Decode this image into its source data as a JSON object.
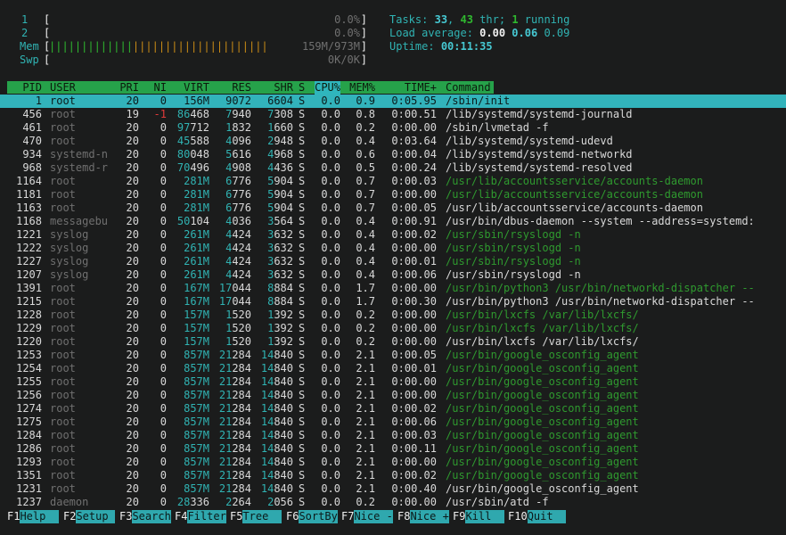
{
  "meters": {
    "cpu1": {
      "label": "1",
      "bar": "",
      "value": "0.0%"
    },
    "cpu2": {
      "label": "2",
      "bar": "",
      "value": "0.0%"
    },
    "mem": {
      "label": "Mem",
      "bar_green": "|||||||||||||",
      "bar_orange": "|||||||||||||||||||||",
      "value": "159M/973M"
    },
    "swp": {
      "label": "Swp",
      "bar": "",
      "value": "0K/0K"
    }
  },
  "summary": {
    "tasks_label": "Tasks:",
    "tasks": "33",
    "threads": "43",
    "thr_label": "thr;",
    "running": "1",
    "running_label": "running",
    "load_label": "Load average:",
    "load1": "0.00",
    "load5": "0.06",
    "load15": "0.09",
    "uptime_label": "Uptime:",
    "uptime": "00:11:35"
  },
  "columns": {
    "pid": "PID",
    "user": "USER",
    "pri": "PRI",
    "ni": "NI",
    "virt": "VIRT",
    "res": "RES",
    "shr": "SHR",
    "s": "S",
    "cpu": "CPU%",
    "mem": "MEM%",
    "time": "TIME+",
    "command": "Command"
  },
  "processes": [
    {
      "pid": "1",
      "user": "root",
      "pri": "20",
      "ni": "0",
      "virt": "156M",
      "res": "9072",
      "shr": "6604",
      "s": "S",
      "cpu": "0.0",
      "mem": "0.9",
      "time": "0:05.95",
      "cmd": "/sbin/init",
      "selected": true
    },
    {
      "pid": "456",
      "user": "root",
      "pri": "19",
      "ni": "-1",
      "virt": "86468",
      "res": "7940",
      "shr": "7308",
      "s": "S",
      "cpu": "0.0",
      "mem": "0.8",
      "time": "0:00.51",
      "cmd": "/lib/systemd/systemd-journald"
    },
    {
      "pid": "461",
      "user": "root",
      "pri": "20",
      "ni": "0",
      "virt": "97712",
      "res": "1832",
      "shr": "1660",
      "s": "S",
      "cpu": "0.0",
      "mem": "0.2",
      "time": "0:00.00",
      "cmd": "/sbin/lvmetad -f"
    },
    {
      "pid": "470",
      "user": "root",
      "pri": "20",
      "ni": "0",
      "virt": "45588",
      "res": "4096",
      "shr": "2948",
      "s": "S",
      "cpu": "0.0",
      "mem": "0.4",
      "time": "0:03.64",
      "cmd": "/lib/systemd/systemd-udevd"
    },
    {
      "pid": "934",
      "user": "systemd-n",
      "pri": "20",
      "ni": "0",
      "virt": "80048",
      "res": "5616",
      "shr": "4968",
      "s": "S",
      "cpu": "0.0",
      "mem": "0.6",
      "time": "0:00.04",
      "cmd": "/lib/systemd/systemd-networkd"
    },
    {
      "pid": "968",
      "user": "systemd-r",
      "pri": "20",
      "ni": "0",
      "virt": "70496",
      "res": "4908",
      "shr": "4436",
      "s": "S",
      "cpu": "0.0",
      "mem": "0.5",
      "time": "0:00.24",
      "cmd": "/lib/systemd/systemd-resolved"
    },
    {
      "pid": "1164",
      "user": "root",
      "pri": "20",
      "ni": "0",
      "virt": "281M",
      "res": "6776",
      "shr": "5904",
      "s": "S",
      "cpu": "0.0",
      "mem": "0.7",
      "time": "0:00.03",
      "cmd": "/usr/lib/accountsservice/accounts-daemon",
      "thread": true
    },
    {
      "pid": "1181",
      "user": "root",
      "pri": "20",
      "ni": "0",
      "virt": "281M",
      "res": "6776",
      "shr": "5904",
      "s": "S",
      "cpu": "0.0",
      "mem": "0.7",
      "time": "0:00.00",
      "cmd": "/usr/lib/accountsservice/accounts-daemon",
      "thread": true
    },
    {
      "pid": "1163",
      "user": "root",
      "pri": "20",
      "ni": "0",
      "virt": "281M",
      "res": "6776",
      "shr": "5904",
      "s": "S",
      "cpu": "0.0",
      "mem": "0.7",
      "time": "0:00.05",
      "cmd": "/usr/lib/accountsservice/accounts-daemon"
    },
    {
      "pid": "1168",
      "user": "messagebu",
      "pri": "20",
      "ni": "0",
      "virt": "50104",
      "res": "4036",
      "shr": "3564",
      "s": "S",
      "cpu": "0.0",
      "mem": "0.4",
      "time": "0:00.91",
      "cmd": "/usr/bin/dbus-daemon --system --address=systemd:"
    },
    {
      "pid": "1221",
      "user": "syslog",
      "pri": "20",
      "ni": "0",
      "virt": "261M",
      "res": "4424",
      "shr": "3632",
      "s": "S",
      "cpu": "0.0",
      "mem": "0.4",
      "time": "0:00.02",
      "cmd": "/usr/sbin/rsyslogd -n",
      "thread": true
    },
    {
      "pid": "1222",
      "user": "syslog",
      "pri": "20",
      "ni": "0",
      "virt": "261M",
      "res": "4424",
      "shr": "3632",
      "s": "S",
      "cpu": "0.0",
      "mem": "0.4",
      "time": "0:00.00",
      "cmd": "/usr/sbin/rsyslogd -n",
      "thread": true
    },
    {
      "pid": "1227",
      "user": "syslog",
      "pri": "20",
      "ni": "0",
      "virt": "261M",
      "res": "4424",
      "shr": "3632",
      "s": "S",
      "cpu": "0.0",
      "mem": "0.4",
      "time": "0:00.01",
      "cmd": "/usr/sbin/rsyslogd -n",
      "thread": true
    },
    {
      "pid": "1207",
      "user": "syslog",
      "pri": "20",
      "ni": "0",
      "virt": "261M",
      "res": "4424",
      "shr": "3632",
      "s": "S",
      "cpu": "0.0",
      "mem": "0.4",
      "time": "0:00.06",
      "cmd": "/usr/sbin/rsyslogd -n"
    },
    {
      "pid": "1391",
      "user": "root",
      "pri": "20",
      "ni": "0",
      "virt": "167M",
      "res": "17044",
      "shr": "8884",
      "s": "S",
      "cpu": "0.0",
      "mem": "1.7",
      "time": "0:00.00",
      "cmd": "/usr/bin/python3 /usr/bin/networkd-dispatcher --",
      "thread": true
    },
    {
      "pid": "1215",
      "user": "root",
      "pri": "20",
      "ni": "0",
      "virt": "167M",
      "res": "17044",
      "shr": "8884",
      "s": "S",
      "cpu": "0.0",
      "mem": "1.7",
      "time": "0:00.30",
      "cmd": "/usr/bin/python3 /usr/bin/networkd-dispatcher --"
    },
    {
      "pid": "1228",
      "user": "root",
      "pri": "20",
      "ni": "0",
      "virt": "157M",
      "res": "1520",
      "shr": "1392",
      "s": "S",
      "cpu": "0.0",
      "mem": "0.2",
      "time": "0:00.00",
      "cmd": "/usr/bin/lxcfs /var/lib/lxcfs/",
      "thread": true
    },
    {
      "pid": "1229",
      "user": "root",
      "pri": "20",
      "ni": "0",
      "virt": "157M",
      "res": "1520",
      "shr": "1392",
      "s": "S",
      "cpu": "0.0",
      "mem": "0.2",
      "time": "0:00.00",
      "cmd": "/usr/bin/lxcfs /var/lib/lxcfs/",
      "thread": true
    },
    {
      "pid": "1220",
      "user": "root",
      "pri": "20",
      "ni": "0",
      "virt": "157M",
      "res": "1520",
      "shr": "1392",
      "s": "S",
      "cpu": "0.0",
      "mem": "0.2",
      "time": "0:00.00",
      "cmd": "/usr/bin/lxcfs /var/lib/lxcfs/"
    },
    {
      "pid": "1253",
      "user": "root",
      "pri": "20",
      "ni": "0",
      "virt": "857M",
      "res": "21284",
      "shr": "14840",
      "s": "S",
      "cpu": "0.0",
      "mem": "2.1",
      "time": "0:00.05",
      "cmd": "/usr/bin/google_osconfig_agent",
      "thread": true
    },
    {
      "pid": "1254",
      "user": "root",
      "pri": "20",
      "ni": "0",
      "virt": "857M",
      "res": "21284",
      "shr": "14840",
      "s": "S",
      "cpu": "0.0",
      "mem": "2.1",
      "time": "0:00.01",
      "cmd": "/usr/bin/google_osconfig_agent",
      "thread": true
    },
    {
      "pid": "1255",
      "user": "root",
      "pri": "20",
      "ni": "0",
      "virt": "857M",
      "res": "21284",
      "shr": "14840",
      "s": "S",
      "cpu": "0.0",
      "mem": "2.1",
      "time": "0:00.00",
      "cmd": "/usr/bin/google_osconfig_agent",
      "thread": true
    },
    {
      "pid": "1256",
      "user": "root",
      "pri": "20",
      "ni": "0",
      "virt": "857M",
      "res": "21284",
      "shr": "14840",
      "s": "S",
      "cpu": "0.0",
      "mem": "2.1",
      "time": "0:00.00",
      "cmd": "/usr/bin/google_osconfig_agent",
      "thread": true
    },
    {
      "pid": "1274",
      "user": "root",
      "pri": "20",
      "ni": "0",
      "virt": "857M",
      "res": "21284",
      "shr": "14840",
      "s": "S",
      "cpu": "0.0",
      "mem": "2.1",
      "time": "0:00.02",
      "cmd": "/usr/bin/google_osconfig_agent",
      "thread": true
    },
    {
      "pid": "1275",
      "user": "root",
      "pri": "20",
      "ni": "0",
      "virt": "857M",
      "res": "21284",
      "shr": "14840",
      "s": "S",
      "cpu": "0.0",
      "mem": "2.1",
      "time": "0:00.06",
      "cmd": "/usr/bin/google_osconfig_agent",
      "thread": true
    },
    {
      "pid": "1284",
      "user": "root",
      "pri": "20",
      "ni": "0",
      "virt": "857M",
      "res": "21284",
      "shr": "14840",
      "s": "S",
      "cpu": "0.0",
      "mem": "2.1",
      "time": "0:00.03",
      "cmd": "/usr/bin/google_osconfig_agent",
      "thread": true
    },
    {
      "pid": "1286",
      "user": "root",
      "pri": "20",
      "ni": "0",
      "virt": "857M",
      "res": "21284",
      "shr": "14840",
      "s": "S",
      "cpu": "0.0",
      "mem": "2.1",
      "time": "0:00.11",
      "cmd": "/usr/bin/google_osconfig_agent",
      "thread": true
    },
    {
      "pid": "1293",
      "user": "root",
      "pri": "20",
      "ni": "0",
      "virt": "857M",
      "res": "21284",
      "shr": "14840",
      "s": "S",
      "cpu": "0.0",
      "mem": "2.1",
      "time": "0:00.00",
      "cmd": "/usr/bin/google_osconfig_agent",
      "thread": true
    },
    {
      "pid": "1351",
      "user": "root",
      "pri": "20",
      "ni": "0",
      "virt": "857M",
      "res": "21284",
      "shr": "14840",
      "s": "S",
      "cpu": "0.0",
      "mem": "2.1",
      "time": "0:00.02",
      "cmd": "/usr/bin/google_osconfig_agent",
      "thread": true
    },
    {
      "pid": "1231",
      "user": "root",
      "pri": "20",
      "ni": "0",
      "virt": "857M",
      "res": "21284",
      "shr": "14840",
      "s": "S",
      "cpu": "0.0",
      "mem": "2.1",
      "time": "0:00.40",
      "cmd": "/usr/bin/google_osconfig_agent"
    },
    {
      "pid": "1237",
      "user": "daemon",
      "pri": "20",
      "ni": "0",
      "virt": "28336",
      "res": "2264",
      "shr": "2056",
      "s": "S",
      "cpu": "0.0",
      "mem": "0.2",
      "time": "0:00.00",
      "cmd": "/usr/sbin/atd -f"
    }
  ],
  "footer": [
    {
      "key": "F1",
      "action": "Help  "
    },
    {
      "key": "F2",
      "action": "Setup "
    },
    {
      "key": "F3",
      "action": "Search"
    },
    {
      "key": "F4",
      "action": "Filter"
    },
    {
      "key": "F5",
      "action": "Tree  "
    },
    {
      "key": "F6",
      "action": "SortBy"
    },
    {
      "key": "F7",
      "action": "Nice -"
    },
    {
      "key": "F8",
      "action": "Nice +"
    },
    {
      "key": "F9",
      "action": "Kill  "
    },
    {
      "key": "F10",
      "action": "Quit  "
    }
  ],
  "colors": {
    "background": "#1b1c1c",
    "header_bar": "#26a24a",
    "selected_row": "#32b3bb",
    "thread_text": "#2fb82f",
    "dim_text": "#707070"
  }
}
